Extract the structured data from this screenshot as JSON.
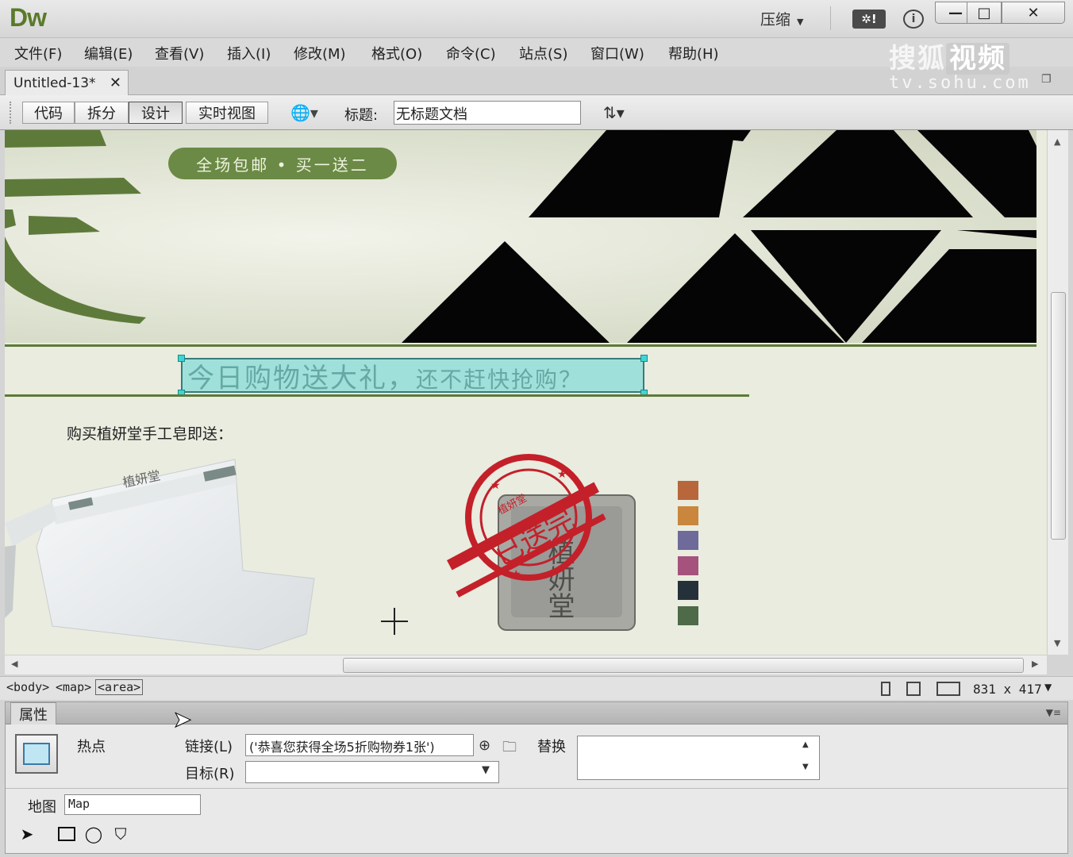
{
  "app": {
    "logo": "Dw",
    "compress_label": "压缩",
    "gear_label": "✲!",
    "info_label": "i"
  },
  "window_buttons": {
    "min": "—",
    "max": "□",
    "close": "✕"
  },
  "menu": [
    "文件(F)",
    "编辑(E)",
    "查看(V)",
    "插入(I)",
    "修改(M)",
    "格式(O)",
    "命令(C)",
    "站点(S)",
    "窗口(W)",
    "帮助(H)"
  ],
  "watermark": {
    "line1_a": "搜狐",
    "line1_b": "视频",
    "line2": "tv.sohu.com"
  },
  "document_tab": {
    "name": "Untitled-13*",
    "close": "✕"
  },
  "doc_toolbar": {
    "views": [
      "代码",
      "拆分",
      "设计",
      "实时视图"
    ],
    "active_view": "设计",
    "title_label": "标题:",
    "title_value": "无标题文档"
  },
  "canvas": {
    "banner_pill": "全场包邮 • 买一送二",
    "hotspot_text_big": "今日购物送大礼，",
    "hotspot_text_small": "还不赶快抢购？",
    "gift_text": "购买植妍堂手工皂即送：",
    "stamp_text": "已送完",
    "stamp_small": "植妍堂",
    "bag_brand": "植妍堂",
    "soap_text": "植妍堂",
    "swatches": [
      "#b8673c",
      "#c9863c",
      "#6e6a99",
      "#a5527d",
      "#25313a",
      "#4e6a49"
    ]
  },
  "status_bar": {
    "tags": [
      "<body>",
      "<map>",
      "<area>"
    ],
    "selected_tag": "<area>",
    "dimensions": "831 x 417"
  },
  "properties": {
    "tab_label": "属性",
    "element_type": "热点",
    "link_label": "链接(L)",
    "link_value": "('恭喜您获得全场5折购物券1张')",
    "target_label": "目标(R)",
    "target_value": "",
    "alt_label": "替换",
    "alt_value": "",
    "map_label": "地图",
    "map_value": "Map"
  }
}
